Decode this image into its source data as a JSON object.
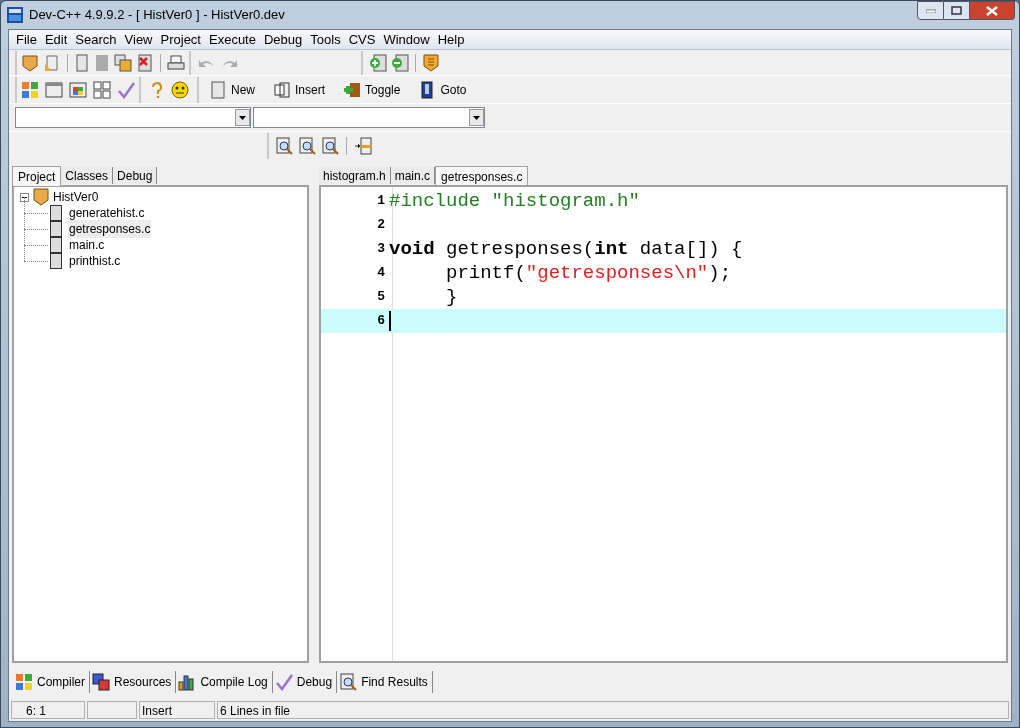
{
  "window": {
    "title": "Dev-C++ 4.9.9.2  - [ HistVer0 ] - HistVer0.dev"
  },
  "menu": [
    "File",
    "Edit",
    "Search",
    "View",
    "Project",
    "Execute",
    "Debug",
    "Tools",
    "CVS",
    "Window",
    "Help"
  ],
  "toolbar_buttons": [
    "New",
    "Insert",
    "Toggle",
    "Goto"
  ],
  "side_tabs": [
    {
      "label": "Project",
      "selected": true
    },
    {
      "label": "Classes",
      "selected": false
    },
    {
      "label": "Debug",
      "selected": false
    }
  ],
  "project_tree": {
    "label": "HistVer0",
    "expanded": true,
    "children": [
      {
        "label": "generatehist.c",
        "selected": false
      },
      {
        "label": "getresponses.c",
        "selected": true
      },
      {
        "label": "main.c",
        "selected": false
      },
      {
        "label": "printhist.c",
        "selected": false
      }
    ]
  },
  "editor_tabs": [
    {
      "label": "histogram.h",
      "selected": false
    },
    {
      "label": "main.c",
      "selected": false
    },
    {
      "label": "getresponses.c",
      "selected": true
    }
  ],
  "code_lines": [
    {
      "number": "1",
      "current": false,
      "tokens": [
        {
          "kind": "preproc",
          "text": "#include \"histogram.h\""
        }
      ]
    },
    {
      "number": "2",
      "current": false
    },
    {
      "number": "3",
      "current": false,
      "tokens": [
        {
          "kind": "keyword",
          "text": "void"
        },
        {
          "kind": "plain",
          "text": " getresponses("
        },
        {
          "kind": "keyword",
          "text": "int"
        },
        {
          "kind": "plain",
          "text": " data[]) {"
        }
      ]
    },
    {
      "number": "4",
      "current": false,
      "tokens": [
        {
          "kind": "plain",
          "text": "     printf("
        },
        {
          "kind": "string",
          "text": "\"getresponses\\n\""
        },
        {
          "kind": "plain",
          "text": ");"
        }
      ]
    },
    {
      "number": "5",
      "current": false,
      "tokens": [
        {
          "kind": "plain",
          "text": "     }"
        }
      ]
    },
    {
      "number": "6",
      "current": true
    }
  ],
  "bottom_tabs": [
    "Compiler",
    "Resources",
    "Compile Log",
    "Debug",
    "Find Results"
  ],
  "status_bar": {
    "position": "6: 1",
    "mode": "Insert",
    "info": "6 Lines in file"
  }
}
